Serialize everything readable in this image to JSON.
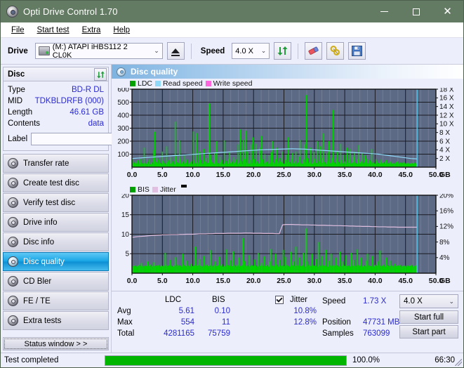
{
  "window": {
    "title": "Opti Drive Control 1.70",
    "icon": "disc-icon",
    "minimize": "–",
    "maximize": "□",
    "close": "✕"
  },
  "menu": {
    "items": [
      {
        "label": "File"
      },
      {
        "label": "Start test"
      },
      {
        "label": "Extra"
      },
      {
        "label": "Help"
      }
    ]
  },
  "toolbar": {
    "drive_label": "Drive",
    "drive_value": "(M:)   ATAPI iHBS112  2 CL0K",
    "eject_icon": "eject-icon",
    "speed_label": "Speed",
    "speed_value": "4.0 X",
    "refresh_icon": "refresh-icon",
    "erase_icon": "eraser-icon",
    "tools_icon": "tools-icon",
    "save_icon": "save-icon",
    "caret": "⌄"
  },
  "disc_panel": {
    "title": "Disc",
    "refresh_icon": "refresh-icon",
    "rows": [
      {
        "key": "Type",
        "value": "BD-R DL"
      },
      {
        "key": "MID",
        "value": "TDKBLDRFB (000)"
      },
      {
        "key": "Length",
        "value": "46.61 GB"
      },
      {
        "key": "Contents",
        "value": "data"
      }
    ],
    "label_key": "Label",
    "label_value": "",
    "label_placeholder": "",
    "label_button_icon": "disc-icon"
  },
  "nav": {
    "items": [
      {
        "label": "Transfer rate",
        "icon": "disc-icon",
        "active": false
      },
      {
        "label": "Create test disc",
        "icon": "disc-icon",
        "active": false
      },
      {
        "label": "Verify test disc",
        "icon": "disc-icon",
        "active": false
      },
      {
        "label": "Drive info",
        "icon": "disc-icon",
        "active": false
      },
      {
        "label": "Disc info",
        "icon": "disc-icon",
        "active": false
      },
      {
        "label": "Disc quality",
        "icon": "disc-icon",
        "active": true
      },
      {
        "label": "CD Bler",
        "icon": "disc-icon",
        "active": false
      },
      {
        "label": "FE / TE",
        "icon": "disc-icon",
        "active": false
      },
      {
        "label": "Extra tests",
        "icon": "disc-icon",
        "active": false
      }
    ],
    "status_window_button": "Status window > >"
  },
  "content_header": {
    "title": "Disc quality",
    "icon": "disc-icon"
  },
  "stats": {
    "col_ldc": "LDC",
    "col_bis": "BIS",
    "jitter_label": "Jitter",
    "jitter_checked": true,
    "rows": [
      {
        "name": "Avg",
        "ldc": "5.61",
        "bis": "0.10",
        "jitter": "10.8%"
      },
      {
        "name": "Max",
        "ldc": "554",
        "bis": "11",
        "jitter": "12.8%"
      },
      {
        "name": "Total",
        "ldc": "4281165",
        "bis": "75759",
        "jitter": ""
      }
    ],
    "speed_key": "Speed",
    "speed_value": "1.73 X",
    "position_key": "Position",
    "position_value": "47731 MB",
    "samples_key": "Samples",
    "samples_value": "763099",
    "speed_select_value": "4.0 X",
    "start_full_button": "Start full",
    "start_part_button": "Start part"
  },
  "statusbar": {
    "status_text": "Test completed",
    "progress_percent": "100.0%",
    "progress_value": 100,
    "elapsed": "66:30"
  },
  "colors": {
    "titlebar": "#637b62",
    "plot_bg": "#5c6a86",
    "ldc_green": "#00d400",
    "read_speed": "#8fd8f7",
    "write_speed": "#ff66dd",
    "jitter_pink": "#e0bfe0",
    "accent_blue": "#17a4e4",
    "value_blue": "#2b2bcf",
    "progress_green": "#00b500"
  },
  "chart_data": [
    {
      "type": "bar",
      "id": "ldc-chart",
      "title": "",
      "xlabel": "GB",
      "ylabel": "",
      "xlim": [
        0,
        50
      ],
      "ylim": [
        0,
        600
      ],
      "y2lim": [
        0,
        18
      ],
      "y2label": "X",
      "xticks": [
        "0.0",
        "5.0",
        "10.0",
        "15.0",
        "20.0",
        "25.0",
        "30.0",
        "35.0",
        "40.0",
        "45.0",
        "50.0"
      ],
      "yticks": [
        "100",
        "200",
        "300",
        "400",
        "500",
        "600"
      ],
      "y2ticks": [
        "2 X",
        "4 X",
        "6 X",
        "8 X",
        "10 X",
        "12 X",
        "14 X",
        "16 X",
        "18 X"
      ],
      "grid": true,
      "legend": [
        {
          "name": "LDC",
          "color": "#00a000",
          "type": "bar"
        },
        {
          "name": "Read speed",
          "color": "#8fd8f7",
          "type": "line"
        },
        {
          "name": "Write speed",
          "color": "#ff66dd",
          "type": "line"
        }
      ],
      "legend_position": "top-left",
      "data_end_gb": 46.9,
      "series": [
        {
          "name": "LDC",
          "type": "bar",
          "color": "#00d400",
          "values": [
            62,
            35,
            28,
            44,
            30,
            52,
            25,
            38,
            62,
            30,
            27,
            150,
            33,
            26,
            41,
            29,
            60,
            22,
            36,
            25,
            130,
            272,
            40,
            70,
            28,
            55,
            32,
            26,
            120,
            47,
            30,
            24,
            160,
            38,
            52,
            27,
            76,
            31,
            45,
            23,
            350,
            86,
            37,
            30,
            205,
            63,
            28,
            42,
            26,
            90,
            34,
            58,
            23,
            36,
            29,
            44,
            26,
            275,
            52,
            30,
            262,
            38,
            27,
            120,
            55,
            31,
            25,
            140,
            43,
            70,
            28,
            33,
            490,
            96,
            55,
            38,
            27,
            110,
            45,
            200,
            31,
            26,
            80,
            37,
            56,
            24,
            205,
            33,
            48,
            27,
            64,
            120,
            30,
            42,
            25,
            77,
            36,
            58,
            23,
            175,
            33,
            290,
            46,
            26,
            210,
            62,
            280,
            34,
            120,
            27,
            55,
            175,
            31,
            230,
            62,
            29,
            180,
            44,
            27,
            150,
            33,
            240,
            60,
            28,
            100,
            36,
            42,
            26,
            88,
            32,
            115,
            200,
            38,
            28,
            60,
            150,
            46,
            30,
            70,
            42,
            120,
            32,
            26,
            55,
            96,
            35,
            230,
            40,
            27,
            62,
            110,
            30,
            44,
            120,
            26,
            35,
            80,
            210,
            31,
            26,
            58,
            175,
            36,
            555,
            68,
            30,
            42,
            150,
            27,
            36,
            120,
            64,
            32,
            200,
            28,
            44,
            160,
            33,
            70,
            260,
            38,
            26,
            110,
            44,
            200,
            30,
            34,
            70,
            440,
            36,
            26,
            62,
            120,
            40,
            28,
            180,
            55,
            30,
            95,
            44,
            27,
            150,
            33,
            62,
            140,
            29,
            36,
            80,
            120,
            34,
            27,
            62,
            170,
            30,
            44,
            110,
            28,
            36,
            90,
            64,
            32,
            28,
            55,
            44,
            140,
            30,
            36,
            27,
            62,
            48,
            33,
            28,
            42,
            60,
            30,
            36,
            26,
            44,
            55,
            30,
            28,
            36,
            42,
            27,
            33,
            30,
            26,
            38,
            44,
            30,
            27,
            36,
            32,
            28,
            40,
            34,
            27,
            30,
            36,
            28,
            26,
            33,
            30,
            27,
            35,
            28,
            31
          ]
        },
        {
          "name": "Read speed",
          "type": "line",
          "color": "#8fd8f7",
          "values": [
            2.0,
            2.05,
            2.1,
            2.15,
            2.2,
            2.25,
            2.3,
            2.35,
            2.4,
            2.45,
            2.5,
            2.55,
            2.6,
            2.65,
            2.7,
            2.75,
            2.8,
            2.85,
            2.9,
            2.95,
            3.0,
            3.05,
            3.1,
            3.15,
            3.2,
            3.25,
            3.3,
            3.35,
            3.4,
            3.45,
            3.5,
            3.55,
            3.6,
            3.65,
            3.7,
            3.75,
            3.8,
            3.85,
            3.9,
            3.95,
            4.0,
            4.02,
            4.05,
            4.08,
            4.1,
            4.12,
            4.15,
            4.18,
            4.2,
            4.22,
            4.25,
            4.22,
            4.2,
            4.18,
            4.15,
            4.1,
            4.05,
            4.0,
            3.95,
            3.9,
            3.85,
            3.8,
            3.75,
            3.7,
            3.65,
            3.6,
            3.55,
            3.5,
            3.45,
            3.4,
            3.35,
            3.3,
            3.25,
            3.2,
            3.15,
            3.1,
            3.05,
            3.0,
            2.9,
            2.8,
            2.7,
            2.6,
            2.5,
            2.4,
            2.3,
            2.2,
            2.1,
            2.0,
            1.95,
            1.9
          ]
        }
      ]
    },
    {
      "type": "bar",
      "id": "bis-chart",
      "title": "",
      "xlabel": "GB",
      "ylabel": "",
      "xlim": [
        0,
        50
      ],
      "ylim": [
        0,
        20
      ],
      "y2lim": [
        0,
        20
      ],
      "y2label": "%",
      "xticks": [
        "0.0",
        "5.0",
        "10.0",
        "15.0",
        "20.0",
        "25.0",
        "30.0",
        "35.0",
        "40.0",
        "45.0",
        "50.0"
      ],
      "yticks": [
        "5",
        "10",
        "15",
        "20"
      ],
      "y2ticks": [
        "4%",
        "8%",
        "12%",
        "16%",
        "20%"
      ],
      "grid": true,
      "legend": [
        {
          "name": "BIS",
          "color": "#00a000",
          "type": "bar"
        },
        {
          "name": "Jitter",
          "color": "#e0bfe0",
          "type": "line"
        }
      ],
      "legend_position": "top-left",
      "data_end_gb": 46.9,
      "series": [
        {
          "name": "BIS",
          "type": "bar",
          "color": "#00d400",
          "values": [
            1.9,
            1.8,
            2.0,
            1.7,
            1.9,
            2.1,
            1.8,
            2.6,
            1.9,
            1.7,
            2.0,
            1.8,
            3.0,
            1.9,
            2.2,
            1.7,
            1.9,
            2.8,
            1.8,
            2.0,
            1.9,
            2.1,
            1.7,
            2.0,
            1.8,
            1.9,
            5.2,
            2.1,
            1.8,
            2.0,
            3.4,
            1.9,
            1.7,
            2.0,
            4.1,
            1.8,
            2.2,
            1.9,
            2.0,
            1.7,
            5.0,
            2.1,
            1.8,
            3.2,
            1.9,
            2.0,
            1.7,
            2.4,
            1.8,
            2.0,
            6.8,
            1.9,
            2.1,
            3.6,
            1.8,
            2.0,
            1.7,
            4.4,
            1.9,
            2.2,
            1.8,
            2.0,
            5.9,
            1.9,
            1.7,
            2.1,
            3.0,
            1.8,
            2.0,
            4.2,
            1.9,
            2.3,
            1.7,
            2.0,
            1.8,
            6.1,
            2.1,
            1.9,
            3.3,
            1.8,
            5.6,
            2.0,
            1.7,
            2.2,
            1.9,
            4.0,
            1.8,
            2.0,
            9.0,
            3.1,
            1.9,
            2.0,
            1.7,
            4.6,
            1.8,
            2.1,
            1.9,
            3.5,
            2.0,
            1.7,
            5.2,
            1.8,
            2.0,
            2.6,
            1.9,
            4.3,
            1.8,
            2.1,
            1.7,
            3.0,
            6.2,
            1.9,
            2.0,
            1.8,
            5.0,
            2.2,
            1.7,
            3.4,
            1.9,
            2.0,
            6.0,
            1.8,
            4.2,
            2.1,
            1.9,
            1.7,
            5.5,
            2.0,
            3.0,
            1.8,
            6.8,
            2.1,
            1.9,
            4.0,
            1.8,
            2.0,
            5.2,
            1.7,
            11.5,
            3.0,
            1.9,
            2.2,
            1.8,
            5.0,
            2.0,
            1.9,
            3.6,
            1.7,
            8.0,
            2.1,
            1.8,
            4.4,
            2.0,
            1.9,
            6.0,
            1.7,
            3.2,
            2.0,
            5.0,
            1.8,
            2.1,
            1.9,
            4.0,
            2.0,
            1.7,
            5.5,
            1.8,
            3.0,
            2.2,
            1.9,
            4.6,
            1.8,
            2.0,
            1.7,
            5.2,
            1.9,
            3.4,
            2.0,
            1.8,
            6.1,
            2.1,
            1.9,
            4.0,
            1.7,
            2.0,
            1.8,
            3.2,
            5.0,
            1.9,
            2.0,
            1.8,
            4.4,
            1.7,
            2.1,
            1.9,
            3.0,
            2.0,
            5.8,
            1.8,
            1.9,
            2.2,
            1.7,
            4.0,
            2.0,
            1.8,
            3.2,
            1.9,
            2.0,
            1.7,
            2.4,
            1.8,
            2.0,
            1.9,
            2.1,
            1.7,
            1.8,
            2.0,
            1.9,
            1.7,
            2.0,
            1.8,
            1.9,
            2.1,
            1.7,
            1.8,
            2.0,
            1.9
          ]
        },
        {
          "name": "Jitter",
          "type": "line",
          "color": "#e0bfe0",
          "values": [
            9.2,
            9.3,
            9.4,
            9.45,
            9.5,
            9.6,
            9.65,
            9.7,
            9.75,
            9.8,
            9.85,
            9.85,
            9.9,
            9.9,
            9.9,
            9.95,
            9.95,
            10.0,
            10.0,
            10.0,
            10.05,
            10.1,
            10.1,
            10.1,
            10.15,
            10.15,
            10.2,
            10.2,
            10.2,
            10.2,
            10.25,
            10.25,
            10.25,
            10.25,
            10.25,
            10.3,
            10.3,
            10.3,
            10.25,
            10.25,
            10.25,
            10.2,
            10.2,
            10.2,
            10.2,
            10.15,
            10.15,
            12.4,
            12.5,
            12.5,
            12.5,
            12.45,
            12.45,
            12.4,
            12.4,
            12.4,
            12.35,
            12.35,
            12.3,
            12.3,
            12.3,
            12.25,
            12.25,
            12.2,
            12.2,
            12.2,
            12.15,
            12.15,
            12.1,
            12.1,
            12.05,
            12.05,
            12.0,
            12.0,
            12.0,
            11.95,
            11.95,
            11.9,
            11.9,
            11.9,
            11.85,
            11.85,
            11.85,
            11.8,
            11.8,
            11.8,
            11.8,
            11.8,
            11.8,
            11.8
          ]
        }
      ]
    }
  ]
}
